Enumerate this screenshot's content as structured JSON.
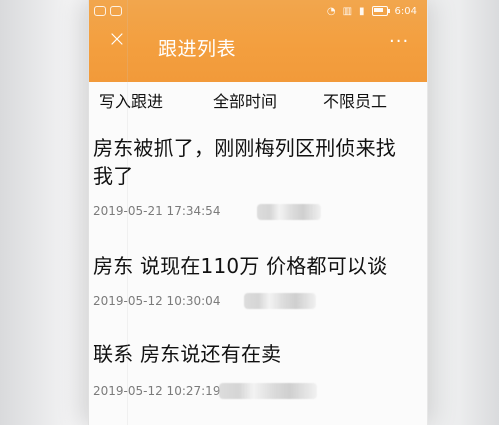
{
  "status": {
    "time": "6:04"
  },
  "header": {
    "title": "跟进列表",
    "close_label": "×",
    "more_label": "···"
  },
  "filters": [
    "写入跟进",
    "全部时间",
    "不限员工"
  ],
  "items": [
    {
      "text": "房东被抓了，刚刚梅列区刑侦来找我了",
      "time": "2019-05-21 17:34:54"
    },
    {
      "text": "房东 说现在110万 价格都可以谈",
      "time": "2019-05-12 10:30:04"
    },
    {
      "text": "联系 房东说还有在卖",
      "time": "2019-05-12 10:27:19"
    }
  ]
}
